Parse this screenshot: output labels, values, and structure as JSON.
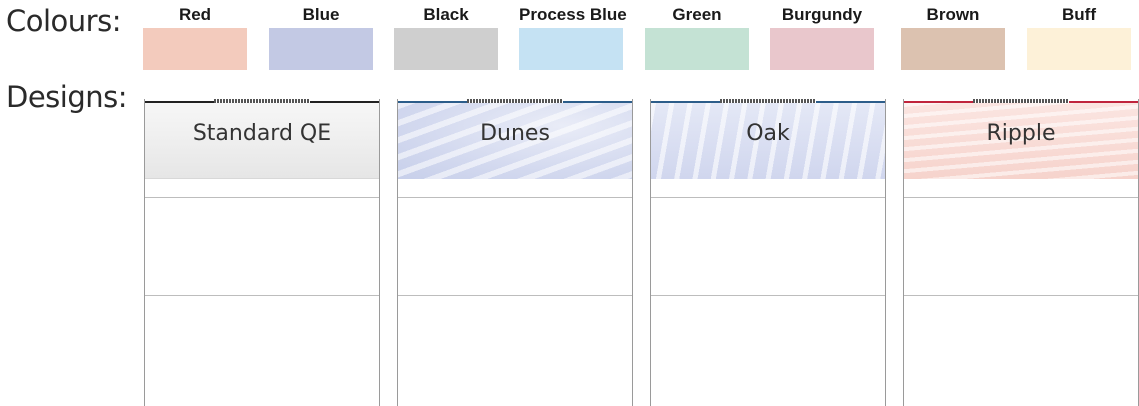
{
  "colours_label": "Colours:",
  "designs_label": "Designs:",
  "colours": [
    {
      "name": "Red",
      "hex": "#f3cbbd"
    },
    {
      "name": "Blue",
      "hex": "#c3c9e4"
    },
    {
      "name": "Black",
      "hex": "#cfcfcf"
    },
    {
      "name": "Process Blue",
      "hex": "#c5e2f3"
    },
    {
      "name": "Green",
      "hex": "#c4e2d4"
    },
    {
      "name": "Burgundy",
      "hex": "#e9c7cc"
    },
    {
      "name": "Brown",
      "hex": "#dcc2b0"
    },
    {
      "name": "Buff",
      "hex": "#fdf1d8"
    }
  ],
  "designs": [
    {
      "name": "Standard QE",
      "accent": "#222222"
    },
    {
      "name": "Dunes",
      "accent": "#2c5d8a"
    },
    {
      "name": "Oak",
      "accent": "#2c5d8a"
    },
    {
      "name": "Ripple",
      "accent": "#c0243c"
    }
  ]
}
